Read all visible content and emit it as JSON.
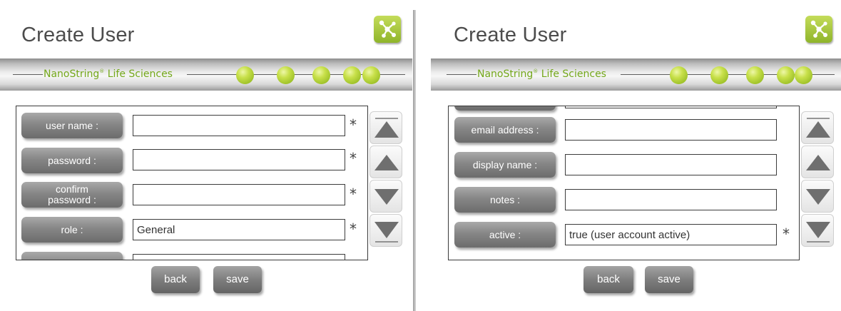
{
  "left": {
    "title": "Create User",
    "brand": "NanoString",
    "brand_reg": "®",
    "brand_suffix": " Life Sciences",
    "fields": [
      {
        "label": "user name :",
        "value": "",
        "required": "*"
      },
      {
        "label": "password :",
        "value": "",
        "required": "*"
      },
      {
        "label": "confirm\npassword :",
        "value": "",
        "required": "*"
      },
      {
        "label": "role :",
        "value": "General",
        "required": "*"
      }
    ],
    "buttons": {
      "back": "back",
      "save": "save"
    }
  },
  "right": {
    "title": "Create User",
    "brand": "NanoString",
    "brand_reg": "®",
    "brand_suffix": " Life Sciences",
    "fields": [
      {
        "label": "email address :",
        "value": ""
      },
      {
        "label": "display name :",
        "value": ""
      },
      {
        "label": "notes :",
        "value": ""
      },
      {
        "label": "active :",
        "value": "true (user account active)",
        "required": "*"
      }
    ],
    "buttons": {
      "back": "back",
      "save": "save"
    }
  },
  "icons": {
    "logo": "molecule-network-icon",
    "scroll_top": "scroll-to-top-icon",
    "scroll_up": "scroll-up-icon",
    "scroll_down": "scroll-down-icon",
    "scroll_bottom": "scroll-to-bottom-icon"
  },
  "colors": {
    "brand_green": "#74a81a",
    "logo_green": "#a6c83a",
    "button_gray": "#808080"
  }
}
